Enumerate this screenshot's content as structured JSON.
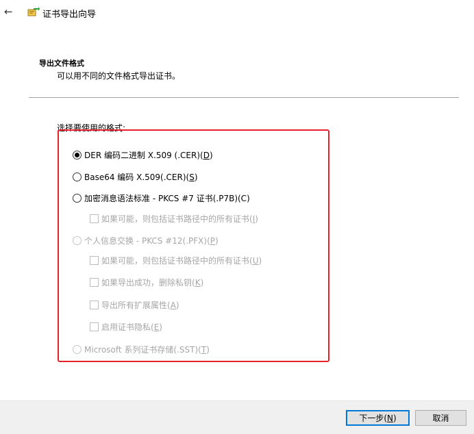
{
  "header": {
    "back_icon": "back-arrow-icon",
    "app_icon": "certificate-export-icon",
    "title": "证书导出向导"
  },
  "section": {
    "title": "导出文件格式",
    "description": "可以用不同的文件格式导出证书。"
  },
  "format": {
    "prompt": "选择要使用的格式:",
    "options": [
      {
        "label": "DER 编码二进制 X.509 (.CER)(",
        "key": "D",
        "suffix": ")",
        "checked": true,
        "enabled": true
      },
      {
        "label": "Base64 编码 X.509(.CER)(",
        "key": "S",
        "suffix": ")",
        "checked": false,
        "enabled": true
      },
      {
        "label": "加密消息语法标准 - PKCS #7 证书(.P7B)(C)",
        "key": "",
        "suffix": "",
        "checked": false,
        "enabled": true
      },
      {
        "label": "如果可能，则包括证书路径中的所有证书(",
        "key": "I",
        "suffix": ")",
        "checked": false,
        "enabled": false
      },
      {
        "label": "个人信息交换 - PKCS #12(.PFX)(",
        "key": "P",
        "suffix": ")",
        "checked": false,
        "enabled": false
      },
      {
        "label": "如果可能，则包括证书路径中的所有证书(",
        "key": "U",
        "suffix": ")",
        "checked": false,
        "enabled": false
      },
      {
        "label": "如果导出成功，删除私钥(",
        "key": "K",
        "suffix": ")",
        "checked": false,
        "enabled": false
      },
      {
        "label": "导出所有扩展属性(",
        "key": "A",
        "suffix": ")",
        "checked": false,
        "enabled": false
      },
      {
        "label": "启用证书隐私(",
        "key": "E",
        "suffix": ")",
        "checked": false,
        "enabled": false
      },
      {
        "label": "Microsoft 系列证书存储(.SST)(",
        "key": "T",
        "suffix": ")",
        "checked": false,
        "enabled": false
      }
    ]
  },
  "buttons": {
    "next_label": "下一步(",
    "next_key": "N",
    "next_suffix": ")",
    "cancel_label": "取消"
  },
  "colors": {
    "highlight": "#e8202a",
    "primary_border": "#0078d7",
    "disabled_text": "#a6a6a6"
  }
}
